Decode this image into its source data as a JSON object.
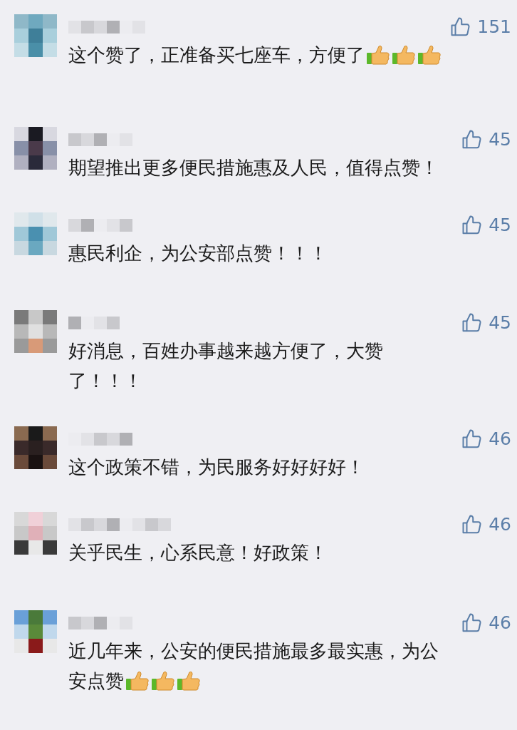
{
  "comments": [
    {
      "likes": "151",
      "lines": [
        "这个赞了，正准备买七座车，方便了"
      ],
      "emojis": [
        {
          "kind": "thumbs_up"
        },
        {
          "kind": "thumbs_up"
        },
        {
          "kind": "thumbs_up"
        }
      ]
    },
    {
      "likes": "45",
      "lines": [
        "期望推出更多便民措施惠及人民，值得点赞！"
      ]
    },
    {
      "likes": "45",
      "lines": [
        "惠民利企，为公安部点赞！！！"
      ]
    },
    {
      "likes": "45",
      "lines": [
        "好消息，百姓办事越来越方便了，大赞",
        "了！！！"
      ]
    },
    {
      "likes": "46",
      "lines": [
        "这个政策不错，为民服务好好好好！"
      ]
    },
    {
      "likes": "46",
      "lines": [
        "关乎民生，心系民意！好政策！"
      ]
    },
    {
      "likes": "46",
      "lines": [
        "近几年来，公安的便民措施最多最实惠，为公",
        "安点赞"
      ],
      "emojis": [
        {
          "kind": "thumbs_up"
        },
        {
          "kind": "thumbs_up"
        },
        {
          "kind": "thumbs_up"
        }
      ]
    }
  ]
}
